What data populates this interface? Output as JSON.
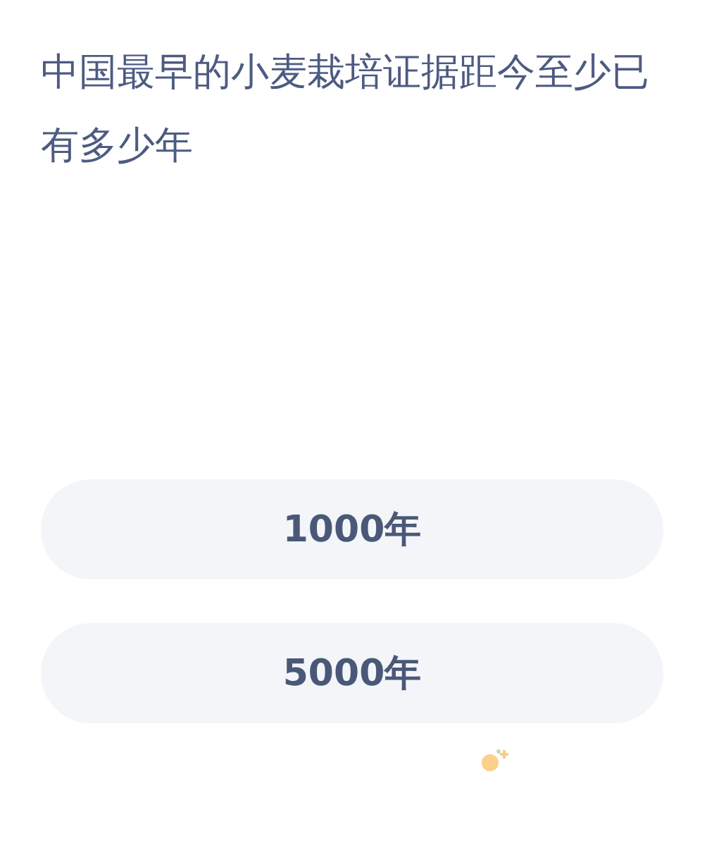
{
  "question": "中国最早的小麦栽培证据距今至少已有多少年",
  "options": [
    {
      "label": "1000年"
    },
    {
      "label": "5000年"
    }
  ]
}
